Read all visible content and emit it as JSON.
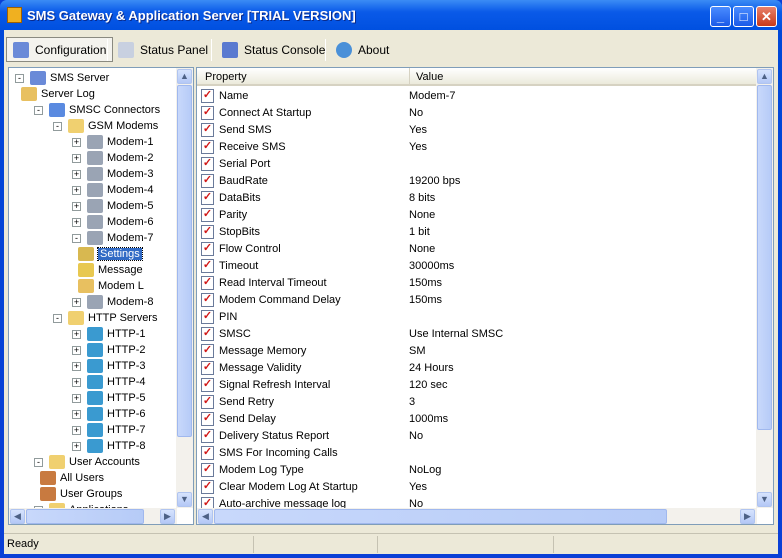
{
  "window": {
    "title": "SMS Gateway & Application Server [TRIAL VERSION]",
    "minimize": "_",
    "maximize": "□",
    "close": "✕"
  },
  "toolbar": [
    {
      "label": "Configuration",
      "icon": "tools-icon",
      "active": true
    },
    {
      "label": "Status Panel",
      "icon": "list-icon"
    },
    {
      "label": "Status Console",
      "icon": "console-icon"
    },
    {
      "label": "About",
      "icon": "info-icon"
    }
  ],
  "tree": [
    {
      "label": "SMS Server",
      "level": 0,
      "exp": "-",
      "icon": "server-icon"
    },
    {
      "label": "Server Log",
      "level": 1,
      "icon": "log-icon"
    },
    {
      "label": "SMSC Connectors",
      "level": 1,
      "exp": "-",
      "icon": "connector-icon"
    },
    {
      "label": "GSM Modems",
      "level": 2,
      "exp": "-",
      "icon": "folder-icon"
    },
    {
      "label": "Modem-1",
      "level": 3,
      "exp": "+",
      "icon": "modem-icon"
    },
    {
      "label": "Modem-2",
      "level": 3,
      "exp": "+",
      "icon": "modem-icon"
    },
    {
      "label": "Modem-3",
      "level": 3,
      "exp": "+",
      "icon": "modem-icon"
    },
    {
      "label": "Modem-4",
      "level": 3,
      "exp": "+",
      "icon": "modem-icon"
    },
    {
      "label": "Modem-5",
      "level": 3,
      "exp": "+",
      "icon": "modem-icon"
    },
    {
      "label": "Modem-6",
      "level": 3,
      "exp": "+",
      "icon": "modem-icon"
    },
    {
      "label": "Modem-7",
      "level": 3,
      "exp": "-",
      "icon": "modem-icon"
    },
    {
      "label": "Settings",
      "level": 4,
      "icon": "settings-icon",
      "selected": true
    },
    {
      "label": "Message",
      "level": 4,
      "icon": "message-icon"
    },
    {
      "label": "Modem L",
      "level": 4,
      "icon": "log-icon"
    },
    {
      "label": "Modem-8",
      "level": 3,
      "exp": "+",
      "icon": "modem-icon"
    },
    {
      "label": "HTTP Servers",
      "level": 2,
      "exp": "-",
      "icon": "folder-icon"
    },
    {
      "label": "HTTP-1",
      "level": 3,
      "exp": "+",
      "icon": "globe-icon"
    },
    {
      "label": "HTTP-2",
      "level": 3,
      "exp": "+",
      "icon": "globe-icon"
    },
    {
      "label": "HTTP-3",
      "level": 3,
      "exp": "+",
      "icon": "globe-icon"
    },
    {
      "label": "HTTP-4",
      "level": 3,
      "exp": "+",
      "icon": "globe-icon"
    },
    {
      "label": "HTTP-5",
      "level": 3,
      "exp": "+",
      "icon": "globe-icon"
    },
    {
      "label": "HTTP-6",
      "level": 3,
      "exp": "+",
      "icon": "globe-icon"
    },
    {
      "label": "HTTP-7",
      "level": 3,
      "exp": "+",
      "icon": "globe-icon"
    },
    {
      "label": "HTTP-8",
      "level": 3,
      "exp": "+",
      "icon": "globe-icon"
    },
    {
      "label": "User Accounts",
      "level": 1,
      "exp": "-",
      "icon": "folder-icon"
    },
    {
      "label": "All Users",
      "level": 2,
      "icon": "users-icon"
    },
    {
      "label": "User Groups",
      "level": 2,
      "icon": "users-icon"
    },
    {
      "label": "Applications",
      "level": 1,
      "exp": "-",
      "icon": "folder-icon"
    }
  ],
  "grid": {
    "headers": [
      "Property",
      "Value"
    ],
    "rows": [
      [
        "Name",
        "Modem-7"
      ],
      [
        "Connect At Startup",
        "No"
      ],
      [
        "Send SMS",
        "Yes"
      ],
      [
        "Receive SMS",
        "Yes"
      ],
      [
        "Serial Port",
        ""
      ],
      [
        "BaudRate",
        "19200 bps"
      ],
      [
        "DataBits",
        "8 bits"
      ],
      [
        "Parity",
        "None"
      ],
      [
        "StopBits",
        "1 bit"
      ],
      [
        "Flow Control",
        "None"
      ],
      [
        "Timeout",
        "30000ms"
      ],
      [
        "Read Interval Timeout",
        "150ms"
      ],
      [
        "Modem Command Delay",
        "150ms"
      ],
      [
        "PIN",
        ""
      ],
      [
        "SMSC",
        "Use Internal SMSC"
      ],
      [
        "Message Memory",
        "SM"
      ],
      [
        "Message Validity",
        "24 Hours"
      ],
      [
        "Signal Refresh Interval",
        "120 sec"
      ],
      [
        "Send Retry",
        "3"
      ],
      [
        "Send Delay",
        "1000ms"
      ],
      [
        "Delivery Status Report",
        "No"
      ],
      [
        "SMS For Incoming Calls",
        ""
      ],
      [
        "Modem Log Type",
        "NoLog"
      ],
      [
        "Clear Modem Log At Startup",
        "Yes"
      ],
      [
        "Auto-archive message log",
        "No"
      ]
    ]
  },
  "status": {
    "text": "Ready"
  },
  "colors": {
    "titlebar": "#0a5ae8",
    "selection": "#316ac5",
    "client": "#ece9d8"
  }
}
